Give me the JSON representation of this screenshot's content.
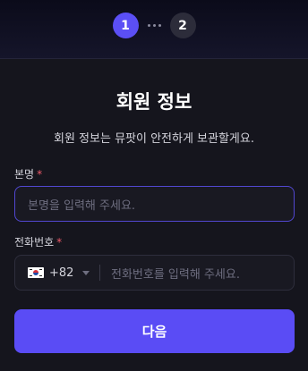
{
  "stepper": {
    "steps": [
      "1",
      "2"
    ],
    "current_step": "1"
  },
  "form": {
    "title": "회원 정보",
    "subtitle": "회원 정보는 뮤팟이 안전하게 보관할게요.",
    "name": {
      "label": "본명",
      "required_mark": "*",
      "placeholder": "본명을 입력해 주세요."
    },
    "phone": {
      "label": "전화번호",
      "required_mark": "*",
      "country_flag_icon": "south-korea-flag-icon",
      "country_code": "+82",
      "placeholder": "전화번호를 입력해 주세요."
    },
    "next_label": "다음"
  },
  "colors": {
    "accent": "#5a4cf5",
    "required": "#f05a6a",
    "background": "#15151d"
  }
}
